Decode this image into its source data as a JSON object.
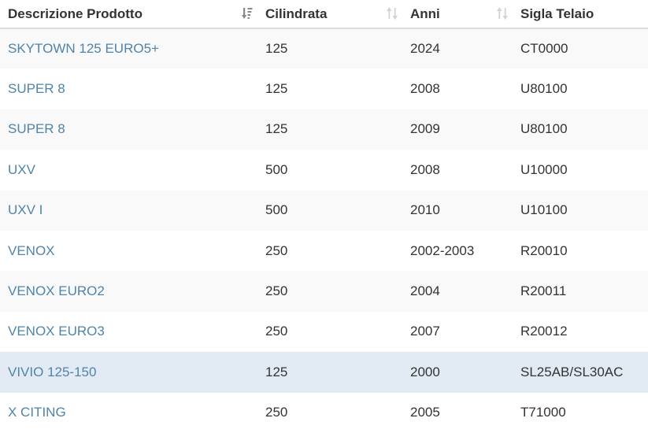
{
  "columns": [
    {
      "label": "Descrizione Prodotto",
      "sort": "sorted-desc-icon"
    },
    {
      "label": "Cilindrata",
      "sort": "sortable-icon"
    },
    {
      "label": "Anni",
      "sort": "sortable-icon"
    },
    {
      "label": "Sigla Telaio",
      "sort": ""
    }
  ],
  "rows": [
    {
      "name": "SKYTOWN 125 EURO5+",
      "cc": "125",
      "years": "2024",
      "frame": "CT0000"
    },
    {
      "name": "SUPER 8",
      "cc": "125",
      "years": "2008",
      "frame": "U80100"
    },
    {
      "name": "SUPER 8",
      "cc": "125",
      "years": "2009",
      "frame": "U80100"
    },
    {
      "name": "UXV",
      "cc": "500",
      "years": "2008",
      "frame": "U10000"
    },
    {
      "name": "UXV I",
      "cc": "500",
      "years": "2010",
      "frame": "U10100"
    },
    {
      "name": "VENOX",
      "cc": "250",
      "years": "2002-2003",
      "frame": "R20010"
    },
    {
      "name": "VENOX EURO2",
      "cc": "250",
      "years": "2004",
      "frame": "R20011"
    },
    {
      "name": "VENOX EURO3",
      "cc": "250",
      "years": "2007",
      "frame": "R20012"
    },
    {
      "name": "VIVIO 125-150",
      "cc": "125",
      "years": "2000",
      "frame": "SL25AB/SL30AC"
    },
    {
      "name": "X CITING",
      "cc": "250",
      "years": "2005",
      "frame": "T71000"
    }
  ],
  "colors": {
    "link": "#4f84ab",
    "stripe": "#f9f9f9",
    "highlight": "#e2ebf3"
  }
}
